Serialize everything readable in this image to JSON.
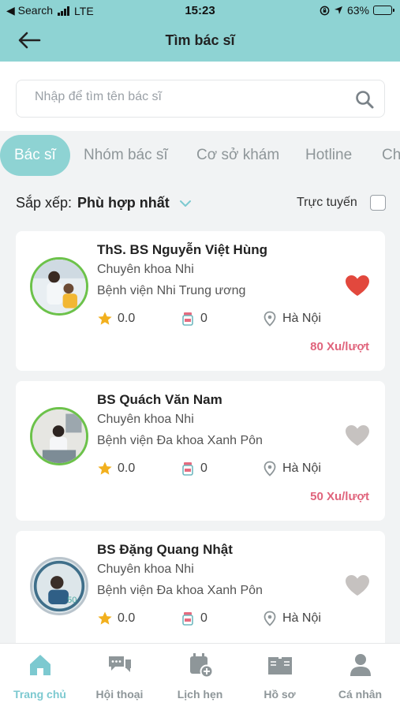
{
  "status_bar": {
    "back_app": "◀ Search",
    "network": "LTE",
    "time": "15:23",
    "battery": "63%",
    "battery_level": 0.63
  },
  "header": {
    "title": "Tìm bác sĩ",
    "back_icon": "arrow-left-icon"
  },
  "search": {
    "placeholder": "Nhập để tìm tên bác sĩ",
    "value": "",
    "icon": "search-icon"
  },
  "tabs": [
    {
      "label": "Bác sĩ",
      "active": true
    },
    {
      "label": "Nhóm bác sĩ",
      "active": false
    },
    {
      "label": "Cơ sở khám",
      "active": false
    },
    {
      "label": "Hotline",
      "active": false
    },
    {
      "label": "Ch",
      "active": false
    }
  ],
  "sort": {
    "label": "Sắp xếp:",
    "value": "Phù hợp nhất",
    "online_label": "Trực tuyến",
    "online_checked": false
  },
  "doctors": [
    {
      "name": "ThS. BS Nguyễn Việt Hùng",
      "specialty": "Chuyên khoa Nhi",
      "hospital": "Bệnh viện Nhi Trung ương",
      "rating": "0.0",
      "consults": "0",
      "location": "Hà Nội",
      "price": "80 Xu/lượt",
      "favorite": true
    },
    {
      "name": "BS Quách Văn Nam",
      "specialty": "Chuyên khoa Nhi",
      "hospital": "Bệnh viện Đa khoa Xanh Pôn",
      "rating": "0.0",
      "consults": "0",
      "location": "Hà Nội",
      "price": "50 Xu/lượt",
      "favorite": false
    },
    {
      "name": "BS Đặng Quang Nhật",
      "specialty": "Chuyên khoa Nhi",
      "hospital": "Bệnh viện Đa khoa Xanh Pôn",
      "rating": "0.0",
      "consults": "0",
      "location": "Hà Nội",
      "price": "",
      "favorite": false
    }
  ],
  "bottom_nav": [
    {
      "label": "Trang chủ",
      "icon": "home-icon",
      "active": true
    },
    {
      "label": "Hội thoại",
      "icon": "chat-icon",
      "active": false
    },
    {
      "label": "Lịch hẹn",
      "icon": "calendar-add-icon",
      "active": false
    },
    {
      "label": "Hồ sơ",
      "icon": "records-icon",
      "active": false
    },
    {
      "label": "Cá nhân",
      "icon": "person-icon",
      "active": false
    }
  ],
  "colors": {
    "accent": "#8ed3d3",
    "heart_active": "#e2483d",
    "heart_inactive": "#c6c2c0",
    "price": "#e0647c",
    "nav_active": "#7cc9d0",
    "nav_inactive": "#8e9699",
    "avatar_ring": "#6cc24a"
  }
}
